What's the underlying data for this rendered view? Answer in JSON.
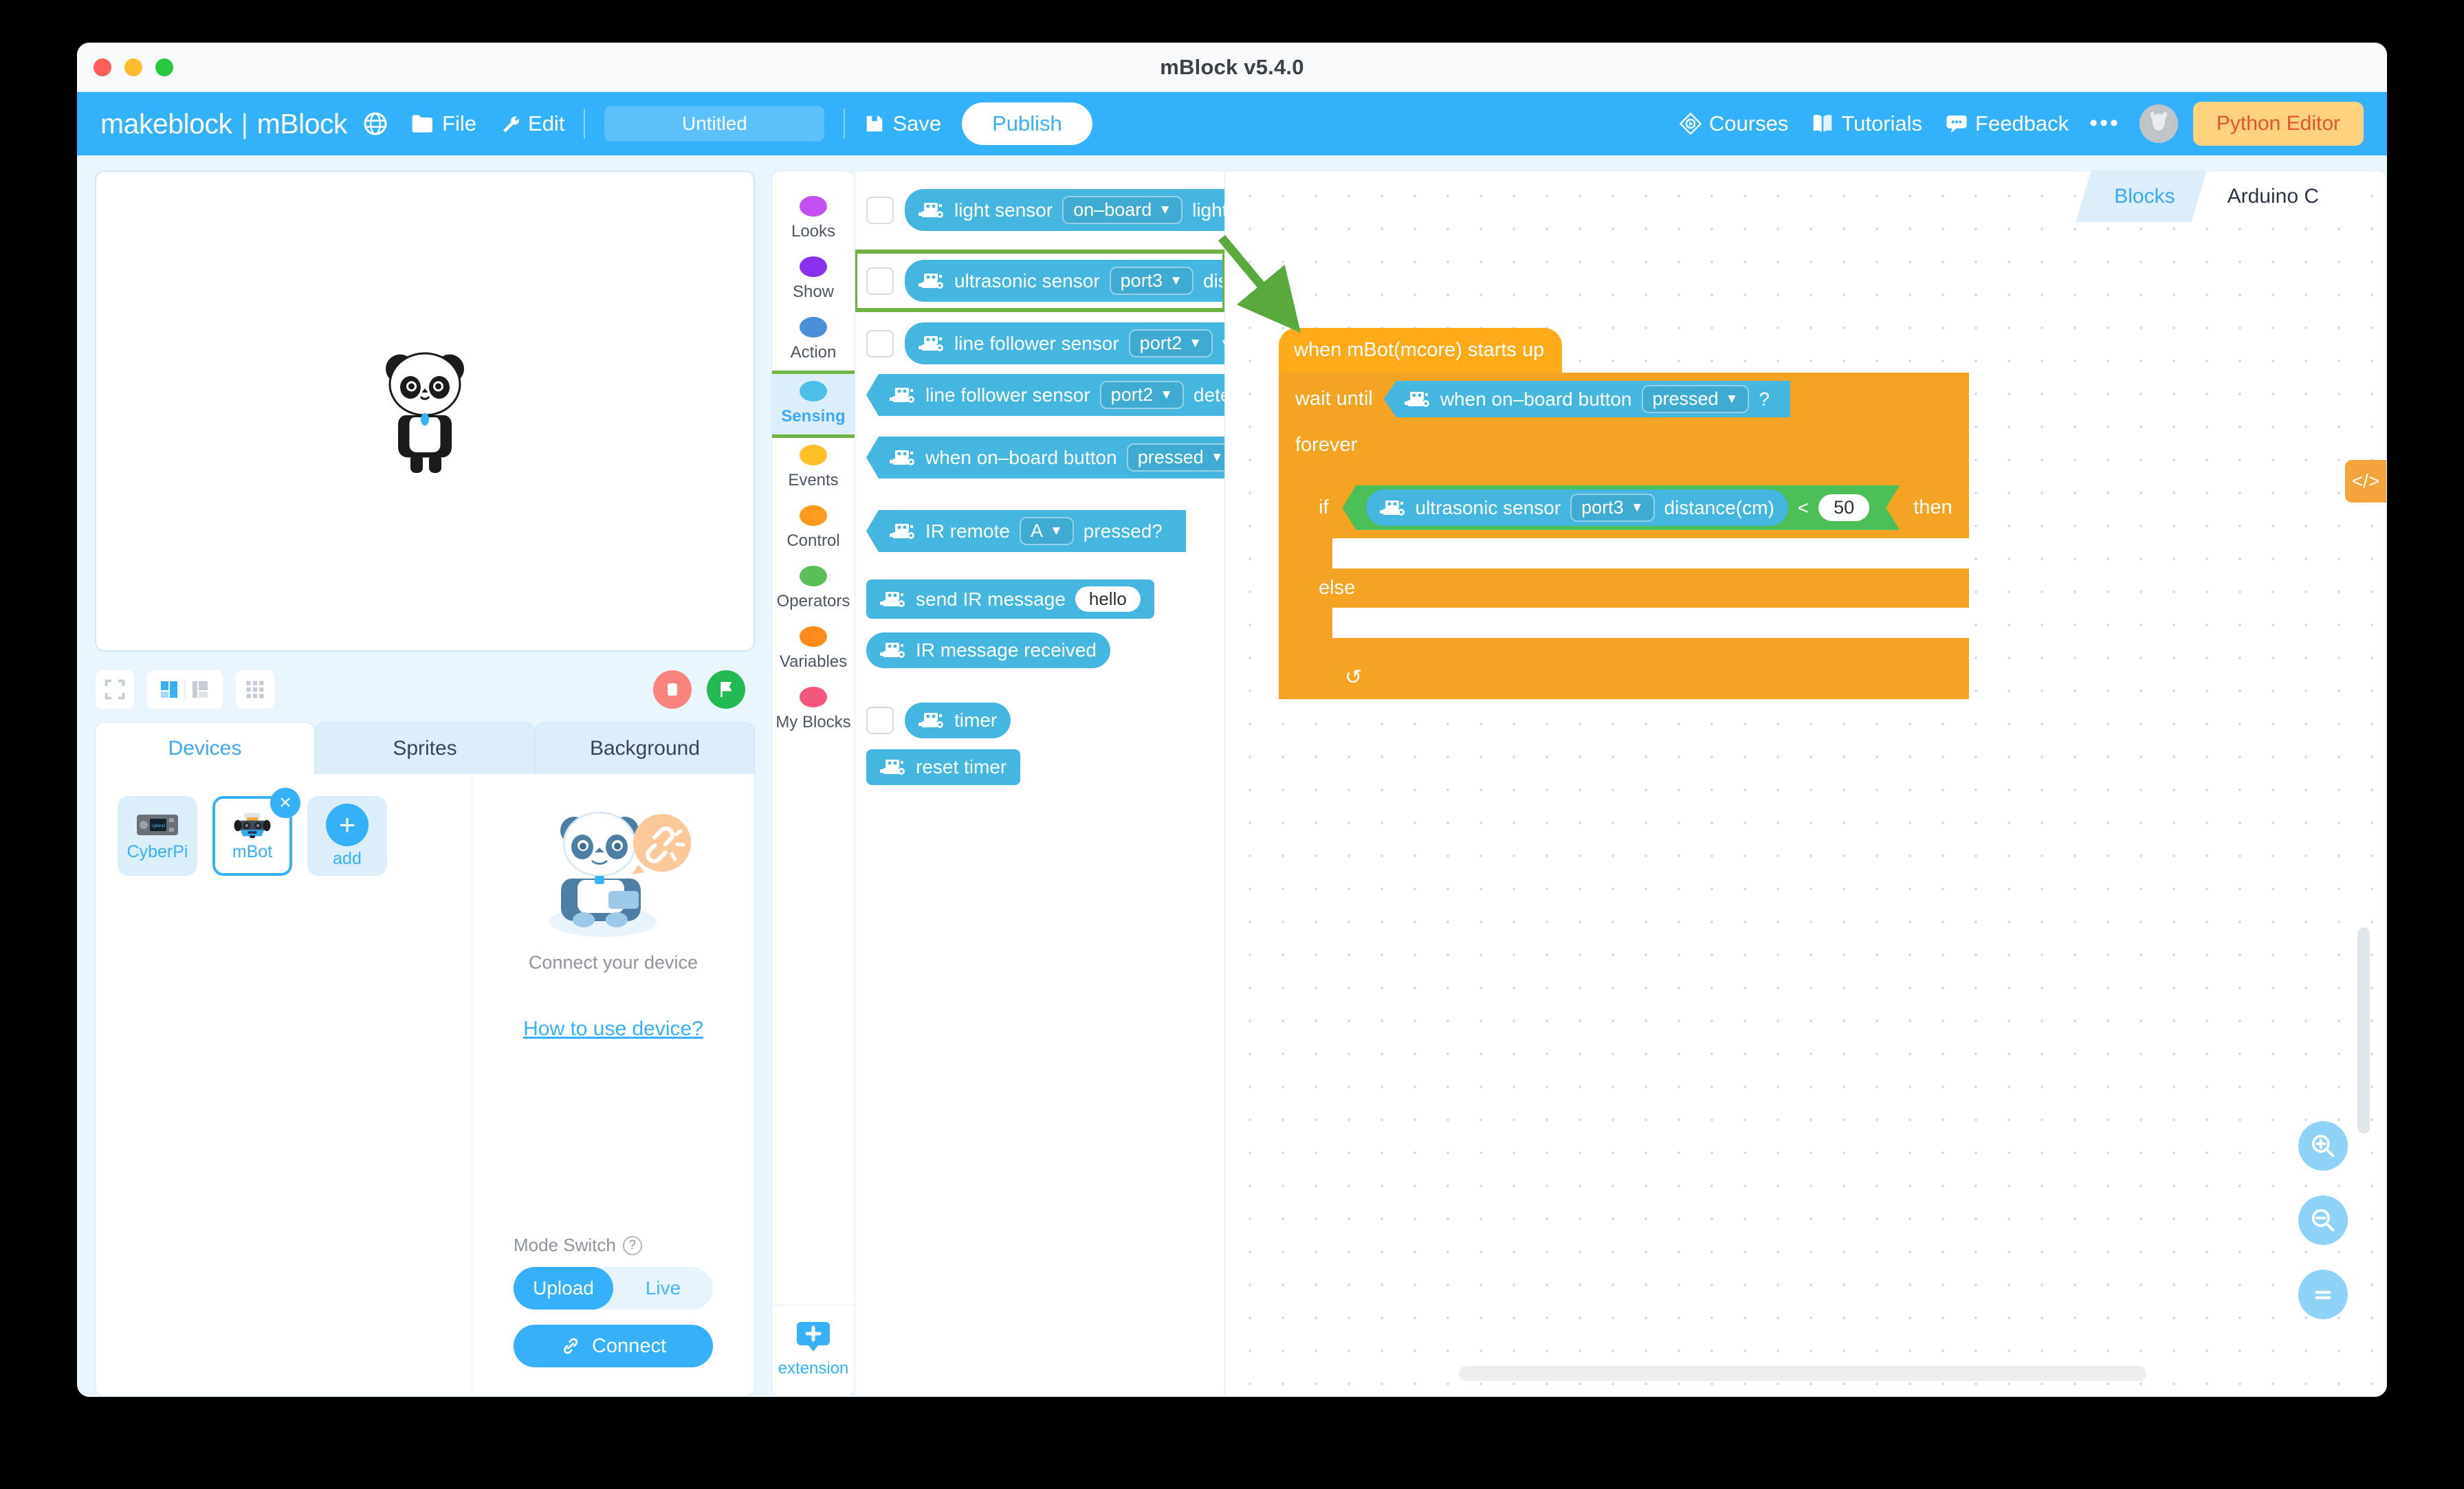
{
  "window": {
    "title": "mBlock v5.4.0"
  },
  "toolbar": {
    "brand_left": "makeblock",
    "brand_sep": "|",
    "brand_right": "mBlock",
    "file_label": "File",
    "edit_label": "Edit",
    "project_name": "Untitled",
    "save_label": "Save",
    "publish_label": "Publish",
    "courses_label": "Courses",
    "tutorials_label": "Tutorials",
    "feedback_label": "Feedback",
    "more_label": "•••",
    "python_editor_label": "Python Editor"
  },
  "stage": {
    "tabs": [
      {
        "label": "Devices",
        "active": true
      },
      {
        "label": "Sprites",
        "active": false
      },
      {
        "label": "Background",
        "active": false
      }
    ]
  },
  "devices": {
    "items": [
      {
        "label": "CyberPi",
        "selected": false
      },
      {
        "label": "mBot",
        "selected": true
      },
      {
        "label": "add",
        "selected": false
      }
    ],
    "close_glyph": "×",
    "add_glyph": "+"
  },
  "connect_panel": {
    "connect_your_device": "Connect your device",
    "how_to_use": "How to use device?",
    "mode_switch_label": "Mode Switch",
    "help_glyph": "?",
    "mode_options": [
      {
        "label": "Upload",
        "active": true
      },
      {
        "label": "Live",
        "active": false
      }
    ],
    "connect_button": "Connect"
  },
  "categories": [
    {
      "label": "Looks",
      "color": "#c44ff0",
      "active": false
    },
    {
      "label": "Show",
      "color": "#8b2ff0",
      "active": false
    },
    {
      "label": "Action",
      "color": "#4a90d9",
      "active": false
    },
    {
      "label": "Sensing",
      "color": "#4cc0e8",
      "active": true
    },
    {
      "label": "Events",
      "color": "#ffbf28",
      "active": false
    },
    {
      "label": "Control",
      "color": "#ff9a1f",
      "active": false
    },
    {
      "label": "Operators",
      "color": "#59c059",
      "active": false
    },
    {
      "label": "Variables",
      "color": "#ff8c1a",
      "active": false
    },
    {
      "label": "My Blocks",
      "color": "#f4567c",
      "active": false
    }
  ],
  "extension": {
    "label": "extension",
    "glyph": "+"
  },
  "palette": {
    "blocks": [
      {
        "id": "light-sensor",
        "checkbox": true,
        "shape": "round",
        "highlighted": false,
        "text1": "light sensor",
        "dropdown": "on–board",
        "text2": "light"
      },
      {
        "id": "ultrasonic-sensor",
        "checkbox": true,
        "shape": "round",
        "highlighted": true,
        "text1": "ultrasonic sensor",
        "dropdown": "port3",
        "text2": "dis"
      },
      {
        "id": "line-follower-value",
        "checkbox": true,
        "shape": "round",
        "highlighted": false,
        "text1": "line follower sensor",
        "dropdown": "port2",
        "text2": "v"
      },
      {
        "id": "line-follower-detect",
        "checkbox": false,
        "shape": "hexa",
        "highlighted": false,
        "text1": "line follower sensor",
        "dropdown": "port2",
        "text2": "dete"
      },
      {
        "id": "on-board-button",
        "checkbox": false,
        "shape": "hexa",
        "highlighted": false,
        "text1": "when on–board button",
        "dropdown": "pressed",
        "text2": ""
      },
      {
        "id": "ir-remote",
        "checkbox": false,
        "shape": "hexa",
        "highlighted": false,
        "text1": "IR remote",
        "dropdown": "A",
        "text2": "pressed?"
      },
      {
        "id": "send-ir-message",
        "checkbox": false,
        "shape": "stack",
        "highlighted": false,
        "text1": "send IR message",
        "input": "hello",
        "text2": ""
      },
      {
        "id": "ir-message-received",
        "checkbox": false,
        "shape": "round",
        "highlighted": false,
        "text1": "IR message received",
        "text2": ""
      },
      {
        "id": "timer",
        "checkbox": true,
        "shape": "round",
        "highlighted": false,
        "text1": "timer",
        "text2": ""
      },
      {
        "id": "reset-timer",
        "checkbox": false,
        "shape": "stack",
        "highlighted": false,
        "text1": "reset timer",
        "text2": ""
      }
    ]
  },
  "code_tabs": [
    {
      "label": "Blocks",
      "active": true
    },
    {
      "label": "Arduino C",
      "active": false
    }
  ],
  "script": {
    "hat": "when mBot(mcore) starts up",
    "wait_until": "wait until",
    "wait_cond_text": "when on–board button",
    "wait_cond_dropdown": "pressed",
    "wait_cond_suffix": "?",
    "forever": "forever",
    "if_label": "if",
    "then_label": "then",
    "else_label": "else",
    "cond_sensor": "ultrasonic sensor",
    "cond_port": "port3",
    "cond_unit": "distance(cm)",
    "cond_operator": "<",
    "cond_value": "50",
    "loop_glyph": "↺"
  },
  "canvas_controls": {
    "code_view_glyph": "</>",
    "zoom_in": "zoom-in",
    "zoom_out": "zoom-out",
    "zoom_reset": "zoom-reset"
  },
  "colors": {
    "accent_blue": "#36b0f9",
    "sensing_block": "#44b6e0",
    "control_block": "#f5a323",
    "events_block": "#ffab19",
    "operator_block": "#4cbf56",
    "highlight_green": "#6fb342",
    "python_btn": "#ffd27f"
  }
}
